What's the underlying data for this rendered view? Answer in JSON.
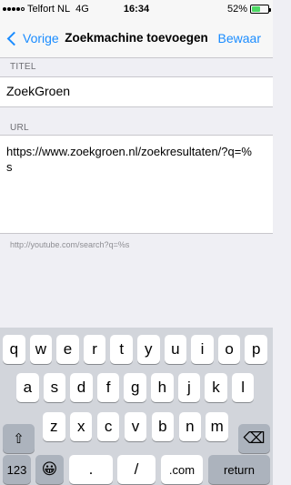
{
  "status_bar": {
    "carrier": "Telfort NL",
    "network": "4G",
    "time": "16:34",
    "battery_text": "52%",
    "battery_level": 0.52,
    "signal_bars": 5,
    "signal_filled": 4
  },
  "nav": {
    "back_label": "Vorige",
    "title": "Zoekmachine toevoegen",
    "save_label": "Bewaar"
  },
  "form": {
    "title_header": "TITEL",
    "title_value": "ZoekGroen",
    "url_header": "URL",
    "url_value": "https://www.zoekgroen.nl/zoekresultaten/?q=%s",
    "footer_hint": "http://youtube.com/search?q=%s"
  },
  "keyboard": {
    "row1": [
      "q",
      "w",
      "e",
      "r",
      "t",
      "y",
      "u",
      "i",
      "o",
      "p"
    ],
    "row2": [
      "a",
      "s",
      "d",
      "f",
      "g",
      "h",
      "j",
      "k",
      "l"
    ],
    "row3": [
      "z",
      "x",
      "c",
      "v",
      "b",
      "n",
      "m"
    ],
    "numbers_label": "123",
    "emoji_label": "😀",
    "dot_label": ".",
    "slash_label": "/",
    "dotcom_label": ".com",
    "return_label": "return",
    "shift_label": "⇧",
    "backspace_label": "⌫"
  },
  "colors": {
    "accent": "#1a8cff",
    "battery": "#4cd964",
    "background": "#efeff4",
    "keyboard_bg": "#d2d5db",
    "key_dark": "#acb3bd"
  }
}
